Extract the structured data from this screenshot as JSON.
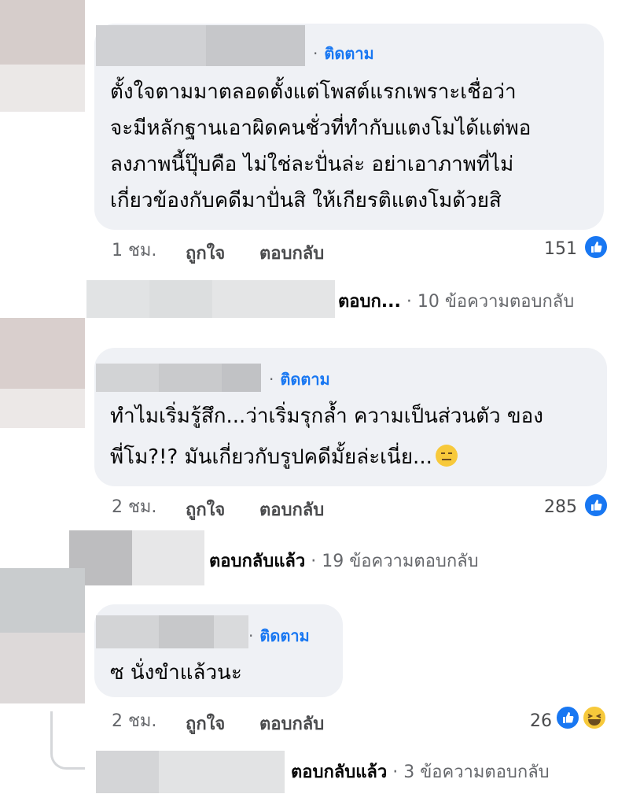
{
  "colors": {
    "link": "#1877f2",
    "bubble": "#eff1f5",
    "muted": "#65676b"
  },
  "comments": [
    {
      "follow_label": "· ติดตาม",
      "lines": [
        "ตั้งใจตามมาตลอดตั้งแต่โพสต์แรกเพราะเชื่อว่า",
        "จะมีหลักฐานเอาผิดคนชั่วที่ทำกับแตงโมได้แต่พอ",
        "ลงภาพนี้ปุ๊บคือ ไม่ใช่ละปั่นล่ะ อย่าเอาภาพที่ไม่",
        "เกี่ยวข้องกับคดีมาปั่นสิ ให้เกียรติแตงโมด้วยสิ"
      ],
      "time": "1 ชม.",
      "like_label": "ถูกใจ",
      "reply_label": "ตอบกลับ",
      "reaction_count": "151",
      "reactions": [
        "like-icon"
      ],
      "replies_who": "ตอบก...",
      "replies_summary": "· 10 ข้อความตอบกลับ"
    },
    {
      "follow_label": "· ติดตาม",
      "lines": [
        "ทำไมเริ่มรู้สึก...ว่าเริ่มรุกล้ำ ความเป็นส่วนตัว ของ",
        "พี่โม?!? มันเกี่ยวกับรูปคดีมั้ยล่ะเนี่ย..."
      ],
      "emoji": "expressionless-face-emoji",
      "time": "2 ชม.",
      "like_label": "ถูกใจ",
      "reply_label": "ตอบกลับ",
      "reaction_count": "285",
      "reactions": [
        "like-icon"
      ],
      "replies_who": "ตอบกลับแล้ว",
      "replies_summary": "· 19 ข้อความตอบกลับ"
    },
    {
      "follow_label": "· ติดตาม",
      "lines": [
        "ซ นั่งขำแล้วนะ"
      ],
      "time": "2 ชม.",
      "like_label": "ถูกใจ",
      "reply_label": "ตอบกลับ",
      "reaction_count": "26",
      "reactions": [
        "like-icon",
        "haha-icon"
      ],
      "replies_who": "ตอบกลับแล้ว",
      "replies_summary": "· 3 ข้อความตอบกลับ"
    }
  ]
}
